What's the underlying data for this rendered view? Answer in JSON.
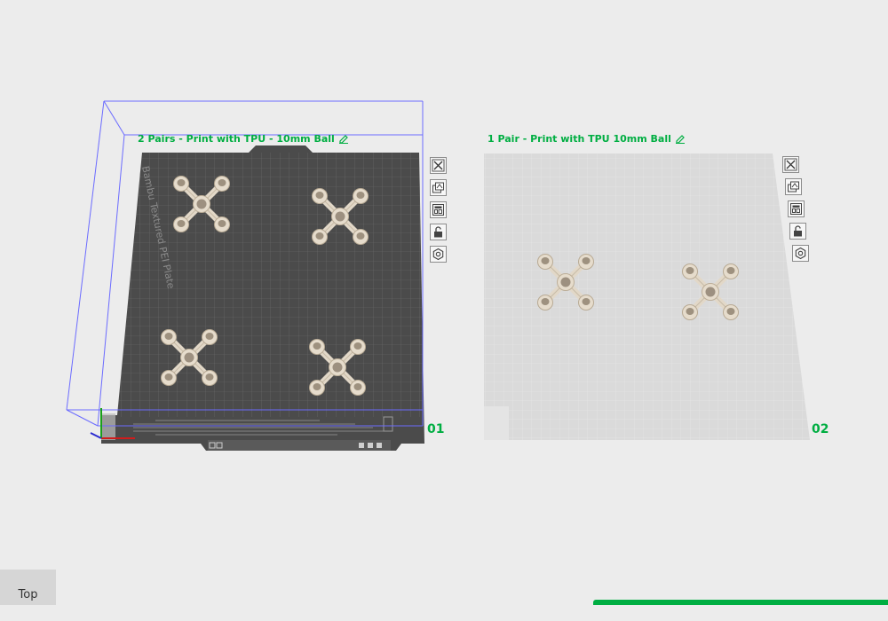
{
  "plates": [
    {
      "number": "01",
      "name": "2 Pairs - Print with TPU - 10mm Ball",
      "plate_label": "Bambu Textured PEI Plate"
    },
    {
      "number": "02",
      "name": "1 Pair - Print with TPU 10mm Ball"
    }
  ],
  "plate_tools": [
    {
      "icon": "close-icon"
    },
    {
      "icon": "auto-orient-icon"
    },
    {
      "icon": "arrange-icon"
    },
    {
      "icon": "lock-icon"
    },
    {
      "icon": "settings-icon"
    }
  ],
  "view_button": "Top",
  "colors": {
    "accent": "#00ae42",
    "pei_plate": "#4b4b4b",
    "empty_plate": "#dadada",
    "model": "#e0d6c6",
    "bounding_box": "#6b6bff"
  }
}
